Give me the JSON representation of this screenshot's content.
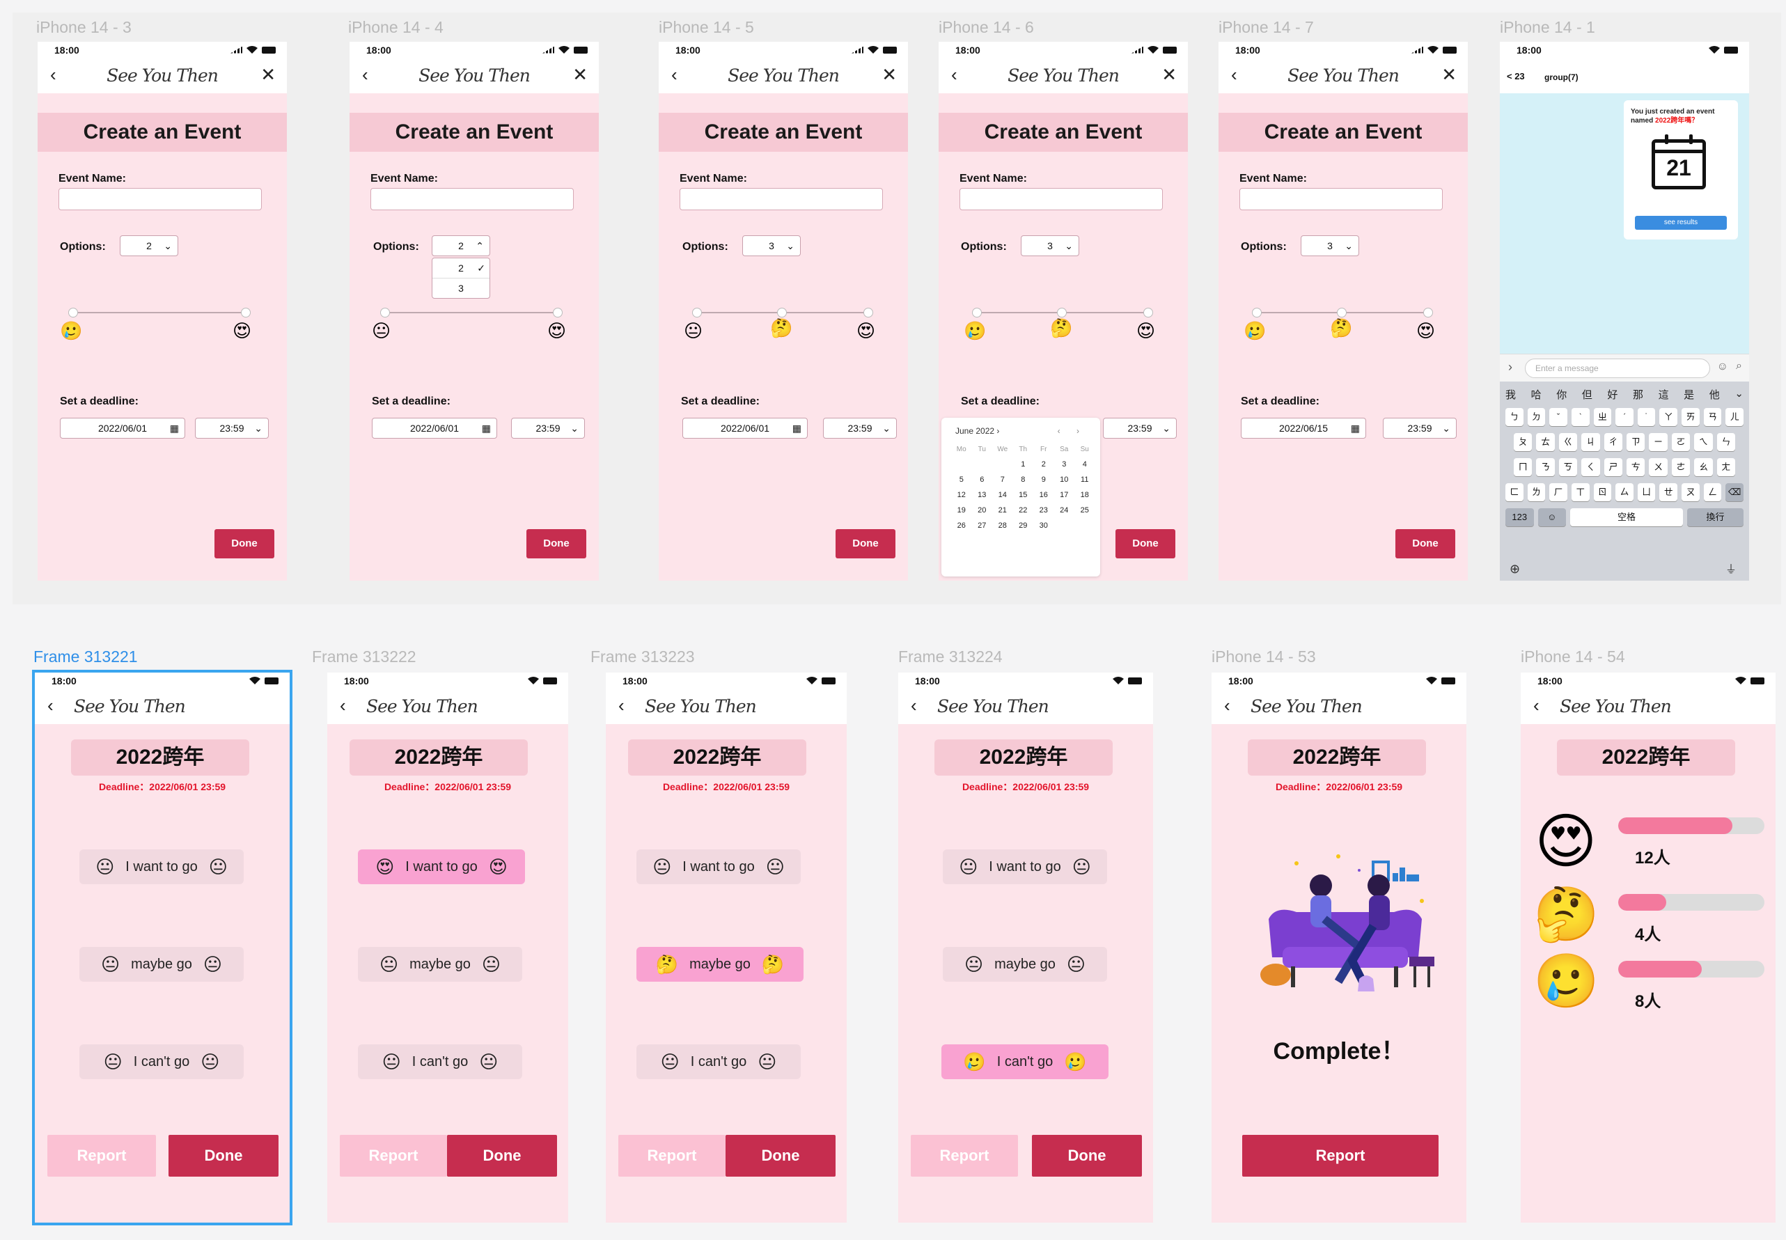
{
  "app": {
    "time": "18:00",
    "title": "See You Then",
    "back_glyph": "‹",
    "close_glyph": "✕"
  },
  "frames": {
    "f1": {
      "label": "iPhone 14 - 3"
    },
    "f2": {
      "label": "iPhone 14 - 4"
    },
    "f3": {
      "label": "iPhone 14 - 5"
    },
    "f4": {
      "label": "iPhone 14 - 6"
    },
    "f5": {
      "label": "iPhone 14 - 7"
    },
    "f6": {
      "label": "iPhone 14 - 1"
    },
    "b1": {
      "label": "Frame 313221"
    },
    "b2": {
      "label": "Frame 313222"
    },
    "b3": {
      "label": "Frame 313223"
    },
    "b4": {
      "label": "Frame 313224"
    },
    "b5": {
      "label": "iPhone 14 - 53"
    },
    "b6": {
      "label": "iPhone 14 - 54"
    }
  },
  "create": {
    "heading": "Create an Event",
    "event_name_label": "Event Name:",
    "options_label": "Options:",
    "deadline_label": "Set a deadline:",
    "done": "Done",
    "f1": {
      "options": "2",
      "date": "2022/06/01",
      "time": "23:59"
    },
    "f2": {
      "options": "2",
      "date": "2022/06/01",
      "time": "23:59",
      "menu": [
        "2",
        "3"
      ]
    },
    "f3": {
      "options": "3",
      "date": "2022/06/01",
      "time": "23:59"
    },
    "f4": {
      "options": "3",
      "time": "23:59"
    },
    "f5": {
      "options": "3",
      "date": "2022/06/15",
      "time": "23:59"
    }
  },
  "calendar": {
    "month": "June 2022 ›",
    "nav": "‹ ›",
    "dow": [
      "Mo",
      "Tu",
      "We",
      "Th",
      "Fr",
      "Sa",
      "Su"
    ],
    "days": [
      "",
      "",
      "",
      "1",
      "2",
      "3",
      "4",
      "5",
      "6",
      "7",
      "8",
      "9",
      "10",
      "11",
      "12",
      "13",
      "14",
      "15",
      "16",
      "17",
      "18",
      "19",
      "20",
      "21",
      "22",
      "23",
      "24",
      "25",
      "26",
      "27",
      "28",
      "29",
      "30"
    ]
  },
  "chat": {
    "back_count": "< 23",
    "group_name": "group(7)",
    "card_text": "You just created an event named",
    "card_event": "2022跨年嗎？",
    "cal_number": "21",
    "see_results": "see results",
    "input_placeholder": "Enter a message",
    "candidates": [
      "我",
      "哈",
      "你",
      "但",
      "好",
      "那",
      "這",
      "是",
      "他",
      "⌄"
    ],
    "row1": [
      "ㄅ",
      "ㄉ",
      "ˇ",
      "ˋ",
      "ㄓ",
      "ˊ",
      "˙",
      "ㄚ",
      "ㄞ",
      "ㄢ",
      "ㄦ"
    ],
    "row2": [
      "ㄆ",
      "ㄊ",
      "ㄍ",
      "ㄐ",
      "ㄔ",
      "ㄗ",
      "ㄧ",
      "ㄛ",
      "ㄟ",
      "ㄣ"
    ],
    "row3": [
      "ㄇ",
      "ㄋ",
      "ㄎ",
      "ㄑ",
      "ㄕ",
      "ㄘ",
      "ㄨ",
      "ㄜ",
      "ㄠ",
      "ㄤ"
    ],
    "row4": [
      "ㄈ",
      "ㄌ",
      "ㄏ",
      "ㄒ",
      "ㄖ",
      "ㄙ",
      "ㄩ",
      "ㄝ",
      "ㄡ",
      "ㄥ",
      "⌫"
    ],
    "row5": [
      "123",
      "☺",
      "空格",
      "換行"
    ]
  },
  "vote": {
    "event_title": "2022跨年",
    "deadline": "Deadline：2022/06/01 23:59",
    "opt1": "I want to go",
    "opt2": "maybe go",
    "opt3": "I can't go",
    "report": "Report",
    "done": "Done",
    "complete": "Complete！"
  },
  "results": [
    {
      "emoji": "😍",
      "count": "12人",
      "fill": 0.78
    },
    {
      "emoji": "🤔",
      "count": "4人",
      "fill": 0.33
    },
    {
      "emoji": "🥲",
      "count": "8人",
      "fill": 0.57
    }
  ],
  "emoji": {
    "neutral": "😐",
    "love": "😍",
    "think": "🤔",
    "sad": "🥲",
    "cal_glyph": "▦"
  },
  "colors": {
    "accent": "#c62d4f",
    "bg": "#fde4ea",
    "banner": "#f6c9d4",
    "selected": "#f9a2d1",
    "deadline": "#e3142b",
    "frame_select": "#3aa5ef"
  }
}
